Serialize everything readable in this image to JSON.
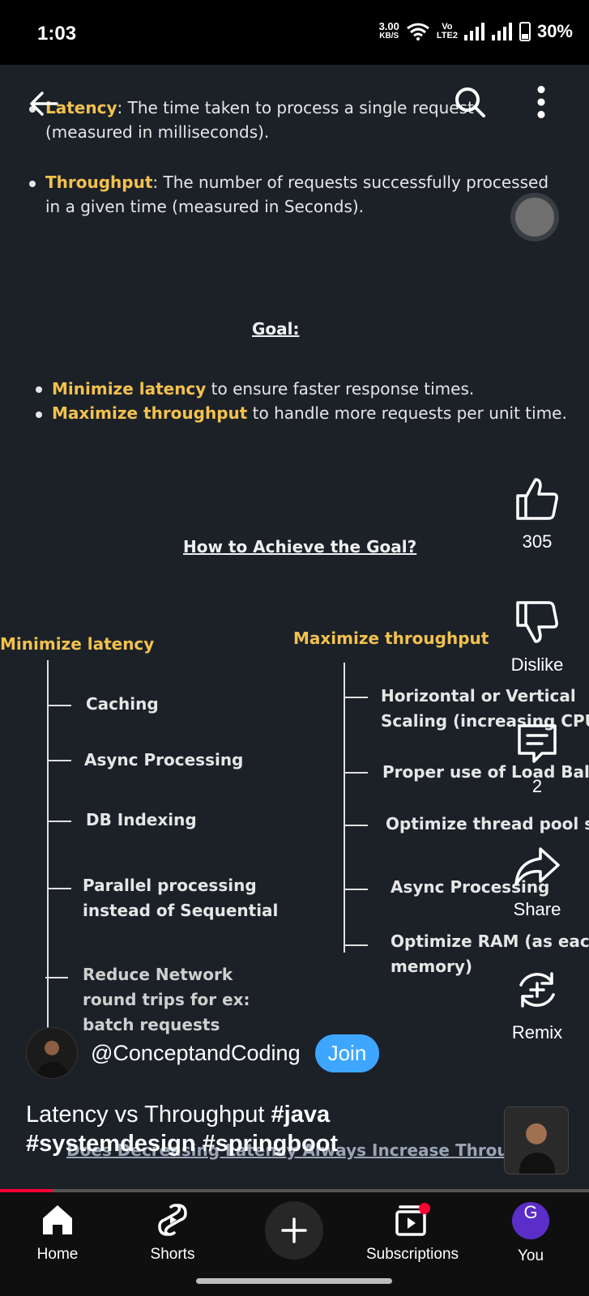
{
  "status_bar": {
    "time": "1:03",
    "net_speed": "3.00",
    "net_unit": "KB/S",
    "lte_top": "Vo",
    "lte_bottom": "LTE2",
    "battery": "30%"
  },
  "slide": {
    "latency_term": "Latency",
    "latency_rest_line1": ": The time taken to process a single request",
    "latency_rest_line2": "(measured in milliseconds).",
    "throughput_term": "Throughput",
    "throughput_rest_line1": ": The number of requests successfully processed",
    "throughput_rest_line2": "in a given time (measured in Seconds).",
    "goal_heading": "Goal:",
    "goal_1_term": "Minimize latency",
    "goal_1_rest": " to ensure faster response times.",
    "goal_2_term": "Maximize throughput",
    "goal_2_rest": " to handle more requests per unit time.",
    "achieve_heading": "How to Achieve the Goal?",
    "left_heading": "Minimize latency",
    "right_heading": "Maximize throughput",
    "left_items": [
      "Caching",
      "Async Processing",
      "DB Indexing",
      "Parallel processing",
      "instead of Sequential",
      "Reduce Network",
      "round trips for ex:",
      "batch requests"
    ],
    "right_items": [
      "Horizontal or Vertical",
      "Scaling (increasing CPU c",
      "Proper use of Load Balan",
      "Optimize thread pool si",
      "Async Processing",
      "Optimize RAM (as each",
      "memory)"
    ],
    "bottom_caption": "Does Decreasing Latency Always Increase Throughput"
  },
  "actions": {
    "like_count": "305",
    "dislike_label": "Dislike",
    "comments_count": "2",
    "share_label": "Share",
    "remix_label": "Remix"
  },
  "channel": {
    "name": "@ConceptandCoding",
    "join_label": "Join"
  },
  "video": {
    "title_plain": "Latency vs Throughput ",
    "title_tag1": "#java",
    "title_tags_line2": "#systemdesign #springboot",
    "progress_fraction": 0.09
  },
  "nav": {
    "home": "Home",
    "shorts": "Shorts",
    "subscriptions": "Subscriptions",
    "you": "You",
    "you_initial": "G"
  },
  "colors": {
    "accent_yellow": "#f2c14e",
    "join_blue": "#3ea6ff",
    "progress_red": "#ff0033",
    "you_purple": "#5b2ec9"
  }
}
